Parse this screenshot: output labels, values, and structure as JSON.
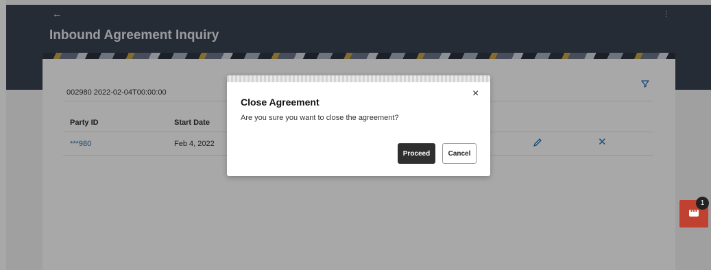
{
  "header": {
    "back_icon": "back-arrow-icon",
    "title": "Inbound Agreement Inquiry",
    "menu_icon": "kebab-menu-icon"
  },
  "record": {
    "summary": "002980  2022-02-04T00:00:00",
    "filter_icon": "filter-icon"
  },
  "table": {
    "columns": [
      "Party ID",
      "Start Date"
    ],
    "rows": [
      {
        "party_id": "***980",
        "start_date": "Feb 4, 2022",
        "edit_icon": "pencil-icon",
        "remove_icon": "close-icon"
      }
    ]
  },
  "modal": {
    "title": "Close Agreement",
    "message": "Are you sure you want to close the agreement?",
    "close_icon": "×",
    "proceed_label": "Proceed",
    "cancel_label": "Cancel"
  },
  "chat": {
    "badge": "1",
    "icon": "chat-icon"
  },
  "colors": {
    "header_bg": "#3b4353",
    "link": "#2a6ea8",
    "primary_button": "#2f2f2f",
    "chat_fab": "#c0412f"
  }
}
